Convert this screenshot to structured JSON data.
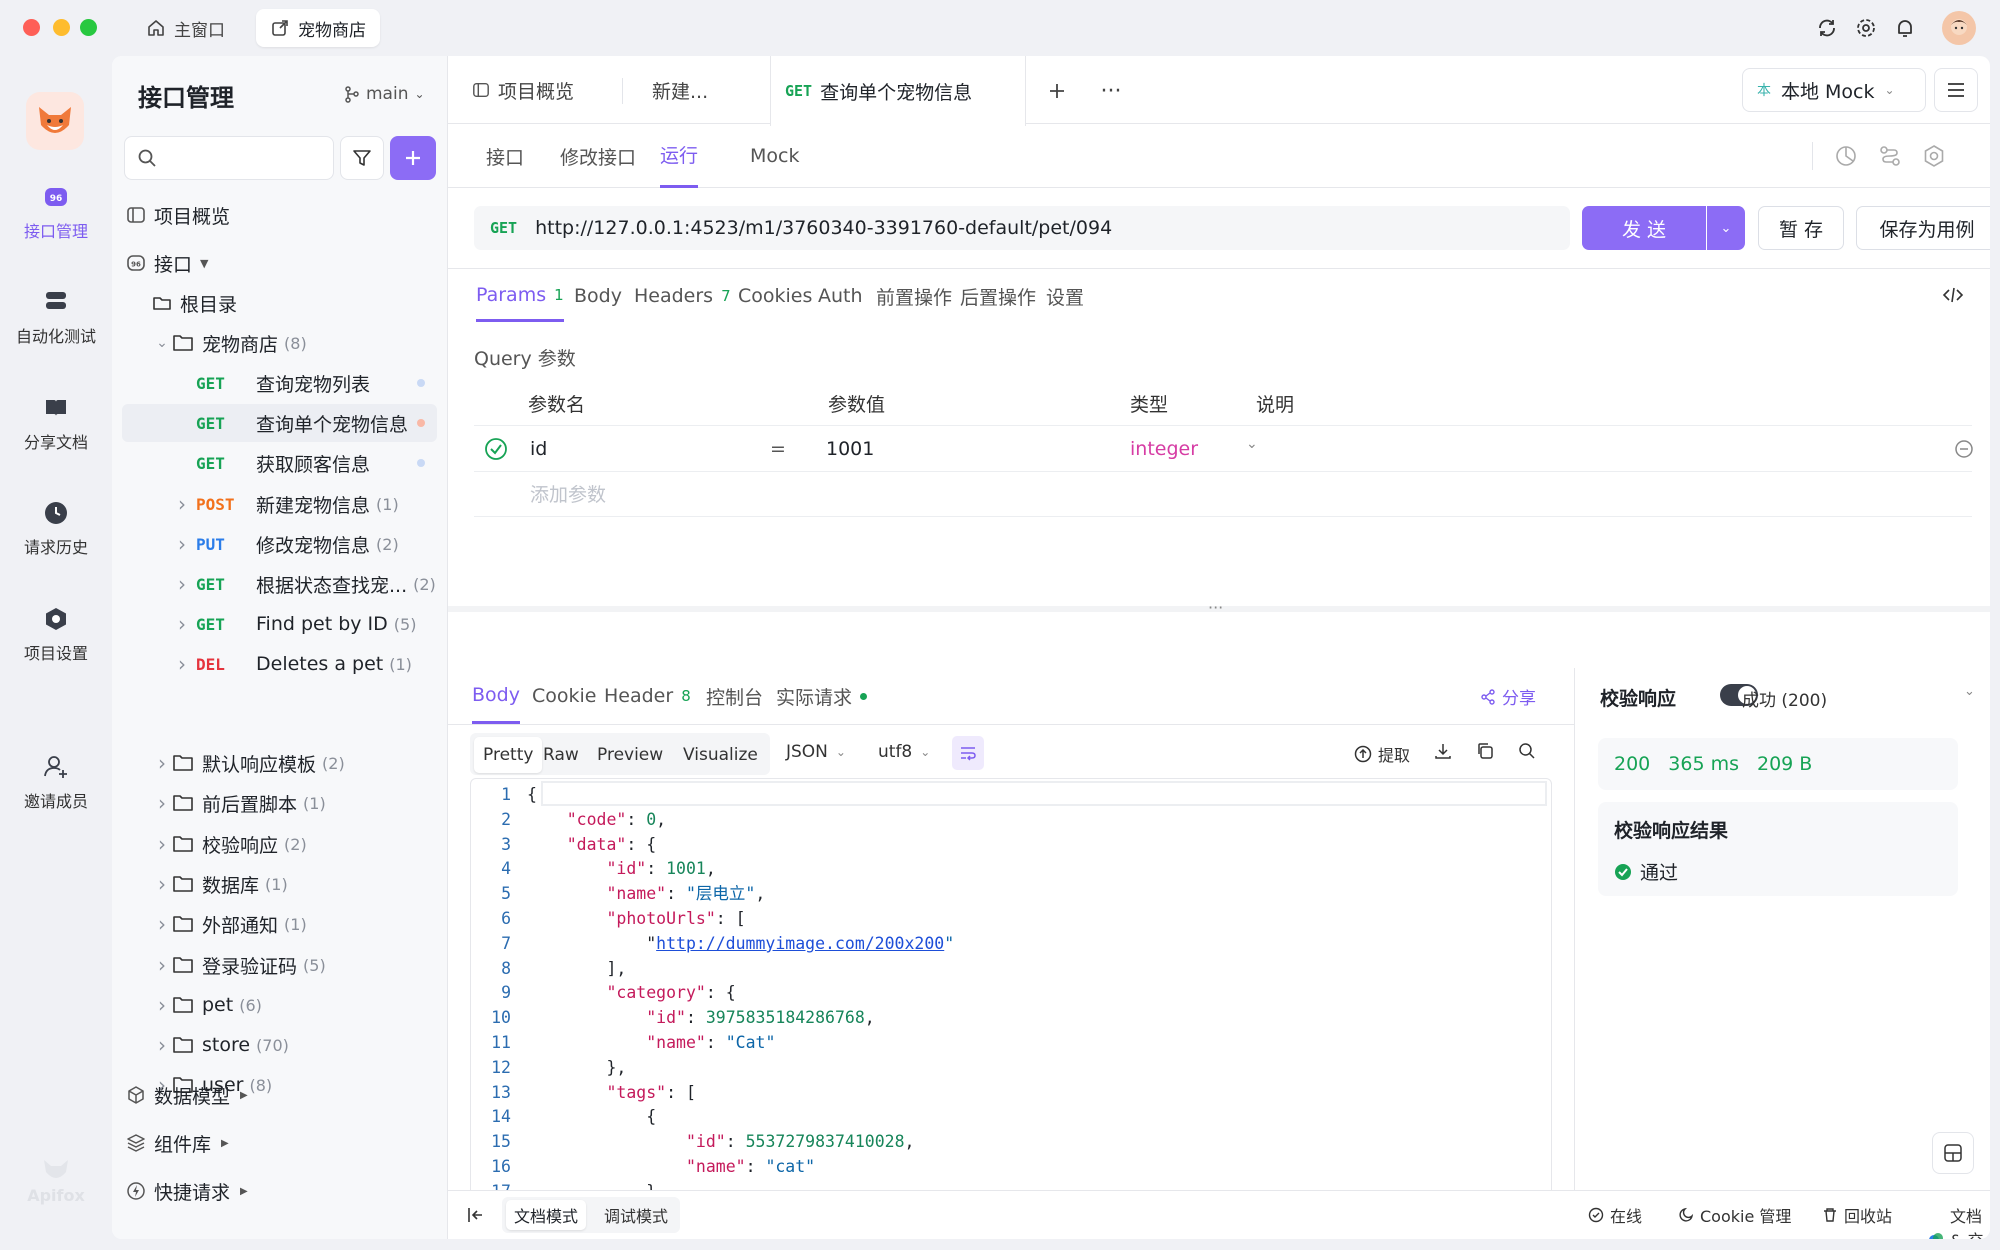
{
  "window_tabs": [
    {
      "label": "主窗口",
      "icon": "home-icon"
    },
    {
      "label": "宠物商店",
      "icon": "external-link-icon"
    }
  ],
  "rail": {
    "brand": "Apifox",
    "items": [
      {
        "label": "接口管理",
        "icon": "api-icon"
      },
      {
        "label": "自动化测试",
        "icon": "automation-icon"
      },
      {
        "label": "分享文档",
        "icon": "book-icon"
      },
      {
        "label": "请求历史",
        "icon": "clock-icon"
      },
      {
        "label": "项目设置",
        "icon": "settings-hex-icon"
      },
      {
        "label": "邀请成员",
        "icon": "add-user-icon"
      }
    ]
  },
  "sidebar": {
    "title": "接口管理",
    "branch": "main",
    "search_placeholder": "",
    "overview": "项目概览",
    "api_root": "接口",
    "root_dir": "根目录",
    "pet_store": {
      "label": "宠物商店",
      "count": "(8)"
    },
    "endpoints": [
      {
        "method": "GET",
        "label": "查询宠物列表",
        "count": ""
      },
      {
        "method": "GET",
        "label": "查询单个宠物信息",
        "count": ""
      },
      {
        "method": "GET",
        "label": "获取顾客信息",
        "count": ""
      },
      {
        "method": "POST",
        "label": "新建宠物信息",
        "count": "(1)"
      },
      {
        "method": "PUT",
        "label": "修改宠物信息",
        "count": "(2)"
      },
      {
        "method": "GET",
        "label": "根据状态查找宠...",
        "count": "(2)"
      },
      {
        "method": "GET",
        "label": "Find pet by ID",
        "count": "(5)"
      },
      {
        "method": "DEL",
        "label": "Deletes a pet",
        "count": "(1)"
      }
    ],
    "folders": [
      {
        "label": "默认响应模板",
        "count": "(2)"
      },
      {
        "label": "前后置脚本",
        "count": "(1)"
      },
      {
        "label": "校验响应",
        "count": "(2)"
      },
      {
        "label": "数据库",
        "count": "(1)"
      },
      {
        "label": "外部通知",
        "count": "(1)"
      },
      {
        "label": "登录验证码",
        "count": "(5)"
      },
      {
        "label": "pet",
        "count": "(6)"
      },
      {
        "label": "store",
        "count": "(70)"
      },
      {
        "label": "user",
        "count": "(8)"
      }
    ],
    "sections": [
      "数据模型",
      "组件库",
      "快捷请求"
    ]
  },
  "doc_tabs": [
    {
      "label": "项目概览"
    },
    {
      "label": "新建..."
    },
    {
      "method": "GET",
      "label": "查询单个宠物信息"
    }
  ],
  "env": {
    "badge": "本",
    "label": "本地 Mock"
  },
  "sub_tabs": [
    "接口",
    "修改接口",
    "运行",
    "Mock"
  ],
  "request": {
    "method": "GET",
    "url": "http://127.0.0.1:4523/m1/3760340-3391760-default/pet/094",
    "send": "发 送",
    "save": "暂 存",
    "save_case": "保存为用例"
  },
  "param_tabs": [
    {
      "label": "Params",
      "badge": "1"
    },
    {
      "label": "Body",
      "badge": ""
    },
    {
      "label": "Headers",
      "badge": "7"
    },
    {
      "label": "Cookies",
      "badge": ""
    },
    {
      "label": "Auth",
      "badge": ""
    },
    {
      "label": "前置操作",
      "badge": ""
    },
    {
      "label": "后置操作",
      "badge": ""
    },
    {
      "label": "设置",
      "badge": ""
    }
  ],
  "query": {
    "title": "Query 参数",
    "headers": [
      "参数名",
      "参数值",
      "类型",
      "说明"
    ],
    "row": {
      "name": "id",
      "eq": "=",
      "value": "1001",
      "type": "integer"
    },
    "add_placeholder": "添加参数"
  },
  "response_tabs": [
    {
      "label": "Body",
      "badge": ""
    },
    {
      "label": "Cookie",
      "badge": ""
    },
    {
      "label": "Header",
      "badge": "8"
    },
    {
      "label": "控制台",
      "badge": ""
    },
    {
      "label": "实际请求",
      "badge": ""
    }
  ],
  "share": "分享",
  "view_modes": [
    "Pretty",
    "Raw",
    "Preview",
    "Visualize"
  ],
  "format": "JSON",
  "encoding": "utf8",
  "extract": "提取",
  "code_lines": [
    [
      [
        "p",
        "{"
      ]
    ],
    [
      [
        "p",
        "    "
      ],
      [
        "k",
        "\"code\""
      ],
      [
        "p",
        ": "
      ],
      [
        "n",
        "0"
      ],
      [
        "p",
        ","
      ]
    ],
    [
      [
        "p",
        "    "
      ],
      [
        "k",
        "\"data\""
      ],
      [
        "p",
        ": {"
      ]
    ],
    [
      [
        "p",
        "        "
      ],
      [
        "k",
        "\"id\""
      ],
      [
        "p",
        ": "
      ],
      [
        "n",
        "1001"
      ],
      [
        "p",
        ","
      ]
    ],
    [
      [
        "p",
        "        "
      ],
      [
        "k",
        "\"name\""
      ],
      [
        "p",
        ": "
      ],
      [
        "s",
        "\"层电立\""
      ],
      [
        "p",
        ","
      ]
    ],
    [
      [
        "p",
        "        "
      ],
      [
        "k",
        "\"photoUrls\""
      ],
      [
        "p",
        ": ["
      ]
    ],
    [
      [
        "p",
        "            \""
      ],
      [
        "link",
        "http://dummyimage.com/200x200"
      ],
      [
        "s",
        "\""
      ]
    ],
    [
      [
        "p",
        "        ],"
      ]
    ],
    [
      [
        "p",
        "        "
      ],
      [
        "k",
        "\"category\""
      ],
      [
        "p",
        ": {"
      ]
    ],
    [
      [
        "p",
        "            "
      ],
      [
        "k",
        "\"id\""
      ],
      [
        "p",
        ": "
      ],
      [
        "n",
        "3975835184286768"
      ],
      [
        "p",
        ","
      ]
    ],
    [
      [
        "p",
        "            "
      ],
      [
        "k",
        "\"name\""
      ],
      [
        "p",
        ": "
      ],
      [
        "s",
        "\"Cat\""
      ]
    ],
    [
      [
        "p",
        "        },"
      ]
    ],
    [
      [
        "p",
        "        "
      ],
      [
        "k",
        "\"tags\""
      ],
      [
        "p",
        ": ["
      ]
    ],
    [
      [
        "p",
        "            {"
      ]
    ],
    [
      [
        "p",
        "                "
      ],
      [
        "k",
        "\"id\""
      ],
      [
        "p",
        ": "
      ],
      [
        "n",
        "5537279837410028"
      ],
      [
        "p",
        ","
      ]
    ],
    [
      [
        "p",
        "                "
      ],
      [
        "k",
        "\"name\""
      ],
      [
        "p",
        ": "
      ],
      [
        "s",
        "\"cat\""
      ]
    ],
    [
      [
        "p",
        "            }"
      ]
    ],
    [
      [
        "p",
        "        ],"
      ]
    ]
  ],
  "validate": {
    "label": "校验响应",
    "status": "成功 (200)",
    "code": "200",
    "time": "365 ms",
    "size": "209 B",
    "result_title": "校验响应结果",
    "result": "通过"
  },
  "footer": {
    "modes": [
      "文档模式",
      "调试模式"
    ],
    "online": "在线",
    "cookie": "Cookie 管理",
    "recycle": "回收站",
    "docs": "文档 & 交流群"
  },
  "colors": {
    "accent": "#7d5cf0",
    "get": "#17a355",
    "post": "#f2711c",
    "put": "#2b7de9",
    "del": "#e5343d"
  }
}
